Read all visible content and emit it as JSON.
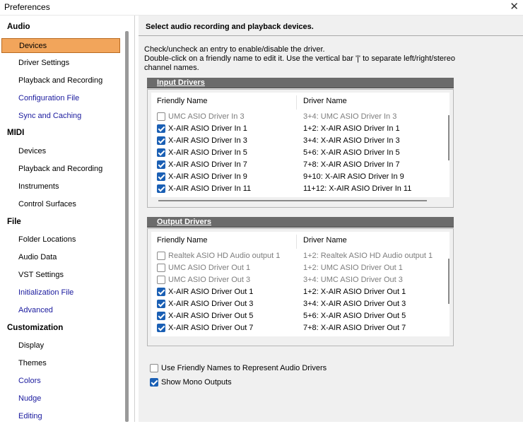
{
  "window": {
    "title": "Preferences",
    "close_glyph": "✕"
  },
  "sidebar": {
    "sections": [
      {
        "label": "Audio",
        "items": [
          "Devices",
          "Driver Settings",
          "Playback and Recording",
          "Configuration File",
          "Sync and Caching"
        ]
      },
      {
        "label": "MIDI",
        "items": [
          "Devices",
          "Playback and Recording",
          "Instruments",
          "Control Surfaces"
        ]
      },
      {
        "label": "File",
        "items": [
          "Folder Locations",
          "Audio Data",
          "VST Settings",
          "Initialization File",
          "Advanced"
        ]
      },
      {
        "label": "Customization",
        "items": [
          "Display",
          "Themes",
          "Colors",
          "Nudge",
          "Editing"
        ]
      }
    ],
    "selected": "Devices",
    "link_items": [
      "Configuration File",
      "Sync and Caching",
      "Initialization File",
      "Advanced",
      "Colors",
      "Nudge",
      "Editing"
    ]
  },
  "main": {
    "header": "Select audio recording and playback devices.",
    "instructions": [
      "Check/uncheck an entry to enable/disable the driver.",
      "Double-click on a friendly name to edit it. Use the vertical bar '|' to separate left/right/stereo",
      "channel names."
    ],
    "columns": {
      "friendly": "Friendly Name",
      "driver": "Driver Name"
    },
    "input": {
      "title": "Input Drivers",
      "rows": [
        {
          "checked": false,
          "friendly": "UMC ASIO Driver In 3",
          "driver": "3+4: UMC ASIO Driver In 3"
        },
        {
          "checked": true,
          "friendly": "X-AIR ASIO Driver In 1",
          "driver": "1+2: X-AIR ASIO Driver In 1"
        },
        {
          "checked": true,
          "friendly": "X-AIR ASIO Driver In 3",
          "driver": "3+4: X-AIR ASIO Driver In 3"
        },
        {
          "checked": true,
          "friendly": "X-AIR ASIO Driver In 5",
          "driver": "5+6: X-AIR ASIO Driver In 5"
        },
        {
          "checked": true,
          "friendly": "X-AIR ASIO Driver In 7",
          "driver": "7+8: X-AIR ASIO Driver In 7"
        },
        {
          "checked": true,
          "friendly": "X-AIR ASIO Driver In 9",
          "driver": "9+10: X-AIR ASIO Driver In 9"
        },
        {
          "checked": true,
          "friendly": "X-AIR ASIO Driver In 11",
          "driver": "11+12: X-AIR ASIO Driver In 11"
        }
      ]
    },
    "output": {
      "title": "Output Drivers",
      "rows": [
        {
          "checked": false,
          "friendly": "Realtek ASIO HD Audio output 1",
          "driver": "1+2: Realtek ASIO HD Audio output 1"
        },
        {
          "checked": false,
          "friendly": "UMC ASIO Driver Out 1",
          "driver": "1+2: UMC ASIO Driver Out 1"
        },
        {
          "checked": false,
          "friendly": "UMC ASIO Driver Out 3",
          "driver": "3+4: UMC ASIO Driver Out 3"
        },
        {
          "checked": true,
          "friendly": "X-AIR ASIO Driver Out 1",
          "driver": "1+2: X-AIR ASIO Driver Out 1"
        },
        {
          "checked": true,
          "friendly": "X-AIR ASIO Driver Out 3",
          "driver": "3+4: X-AIR ASIO Driver Out 3"
        },
        {
          "checked": true,
          "friendly": "X-AIR ASIO Driver Out 5",
          "driver": "5+6: X-AIR ASIO Driver Out 5"
        },
        {
          "checked": true,
          "friendly": "X-AIR ASIO Driver Out 7",
          "driver": "7+8: X-AIR ASIO Driver Out 7"
        }
      ]
    },
    "options": [
      {
        "checked": false,
        "label": "Use Friendly Names to Represent Audio Drivers"
      },
      {
        "checked": true,
        "label": "Show Mono Outputs"
      }
    ]
  },
  "colors": {
    "selected_bg": "#f2a55b",
    "group_title_bg": "#6b6b6b",
    "checkbox_on": "#1a5fb4",
    "link_text": "#1a1a9e"
  }
}
